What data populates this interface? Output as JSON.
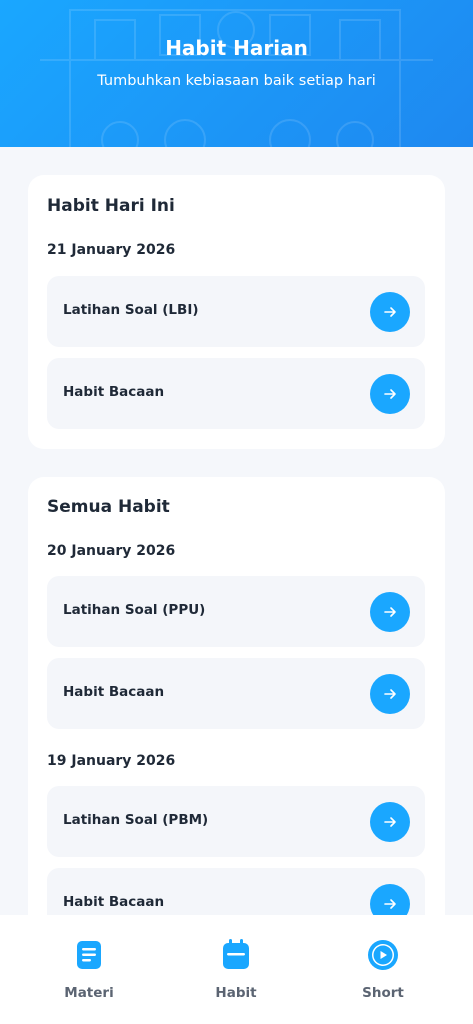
{
  "header": {
    "title": "Habit Harian",
    "subtitle": "Tumbuhkan kebiasaan baik setiap hari"
  },
  "today": {
    "title": "Habit Hari Ini",
    "date": "21 January 2026",
    "items": [
      {
        "label": "Latihan Soal (LBI)"
      },
      {
        "label": "Habit Bacaan"
      }
    ]
  },
  "all": {
    "title": "Semua Habit",
    "groups": [
      {
        "date": "20 January 2026",
        "items": [
          {
            "label": "Latihan Soal (PPU)"
          },
          {
            "label": "Habit Bacaan"
          }
        ]
      },
      {
        "date": "19 January 2026",
        "items": [
          {
            "label": "Latihan Soal (PBM)"
          },
          {
            "label": "Habit Bacaan"
          }
        ]
      }
    ]
  },
  "nav": {
    "items": [
      {
        "label": "Materi",
        "icon": "document-icon"
      },
      {
        "label": "Habit",
        "icon": "calendar-icon"
      },
      {
        "label": "Short",
        "icon": "play-icon"
      }
    ]
  },
  "colors": {
    "accent": "#1aa7ff",
    "header_gradient_end": "#1e88f0",
    "item_bg": "#f4f6fa",
    "page_bg": "#f5f7fb"
  }
}
